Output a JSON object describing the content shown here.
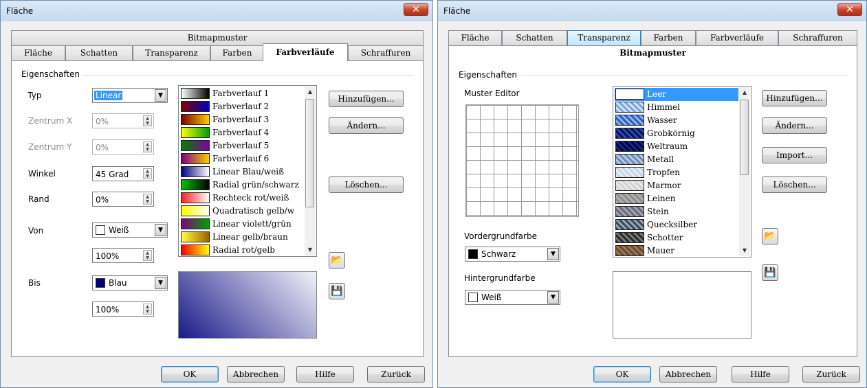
{
  "left_dialog": {
    "title": "Fläche",
    "close_glyph": "✕",
    "tabs_row1": [
      "Bitmapmuster"
    ],
    "tabs_row2": [
      "Fläche",
      "Schatten",
      "Transparenz",
      "Farben",
      "Farbverläufe",
      "Schraffuren"
    ],
    "selected_tab": "Farbverläufe",
    "group_label": "Eigenschaften",
    "labels": {
      "typ": "Typ",
      "zentrum_x": "Zentrum X",
      "zentrum_y": "Zentrum Y",
      "winkel": "Winkel",
      "rand": "Rand",
      "von": "Von",
      "bis": "Bis"
    },
    "typ_value": "Linear",
    "zentrum_x_value": "0%",
    "zentrum_y_value": "0%",
    "winkel_value": "45 Grad",
    "rand_value": "0%",
    "von_color_name": "Weiß",
    "von_color": "#ffffff",
    "von_intensity": "100%",
    "bis_color_name": "Blau",
    "bis_color": "#000080",
    "bis_intensity": "100%",
    "gradients": [
      {
        "name": "Farbverlauf 1",
        "c1": "#ffffff",
        "c2": "#000000"
      },
      {
        "name": "Farbverlauf 2",
        "c1": "#800000",
        "c2": "#0000c0"
      },
      {
        "name": "Farbverlauf 3",
        "c1": "#800000",
        "c2": "#ffcc00"
      },
      {
        "name": "Farbverlauf 4",
        "c1": "#ffff00",
        "c2": "#00a000"
      },
      {
        "name": "Farbverlauf 5",
        "c1": "#008000",
        "c2": "#8000a0"
      },
      {
        "name": "Farbverlauf 6",
        "c1": "#800080",
        "c2": "#ffcc00"
      },
      {
        "name": "Linear Blau/weiß",
        "c1": "#000080",
        "c2": "#ffffff"
      },
      {
        "name": "Radial grün/schwarz",
        "c1": "#00c000",
        "c2": "#000000"
      },
      {
        "name": "Rechteck rot/weiß",
        "c1": "#ff2020",
        "c2": "#ffffff"
      },
      {
        "name": "Quadratisch gelb/w",
        "c1": "#ffff00",
        "c2": "#ffffff"
      },
      {
        "name": "Linear violett/grün",
        "c1": "#800080",
        "c2": "#00a000"
      },
      {
        "name": "Linear gelb/braun",
        "c1": "#ffff40",
        "c2": "#a06000"
      },
      {
        "name": "Radial rot/gelb",
        "c1": "#ff0000",
        "c2": "#ffff00"
      }
    ],
    "buttons": {
      "hinzufuegen": "Hinzufügen...",
      "aendern": "Ändern...",
      "loeschen": "Löschen...",
      "ok": "OK",
      "abbrechen": "Abbrechen",
      "hilfe": "Hilfe",
      "zurueck": "Zurück"
    }
  },
  "right_dialog": {
    "title": "Fläche",
    "close_glyph": "✕",
    "tabs_row1": [
      "Fläche",
      "Schatten",
      "Transparenz",
      "Farben",
      "Farbverläufe",
      "Schraffuren"
    ],
    "highlighted_tab": "Transparenz",
    "selected_tab": "Bitmapmuster",
    "group_label": "Eigenschaften",
    "muster_editor_label": "Muster Editor",
    "vordergrund_label": "Vordergrundfarbe",
    "vordergrund_value": "Schwarz",
    "vordergrund_color": "#000000",
    "hintergrund_label": "Hintergrundfarbe",
    "hintergrund_value": "Weiß",
    "hintergrund_color": "#ffffff",
    "bitmaps": [
      {
        "name": "Leer",
        "c1": "#ffffff",
        "c2": "#ffffff"
      },
      {
        "name": "Himmel",
        "c1": "#7aa7e0",
        "c2": "#d6e6fa"
      },
      {
        "name": "Wasser",
        "c1": "#2e62b8",
        "c2": "#8fb7ef"
      },
      {
        "name": "Grobkörnig",
        "c1": "#0a1450",
        "c2": "#2f49b8"
      },
      {
        "name": "Weltraum",
        "c1": "#00053a",
        "c2": "#1a2a8a"
      },
      {
        "name": "Metall",
        "c1": "#6d8db8",
        "c2": "#b9cbe3"
      },
      {
        "name": "Tropfen",
        "c1": "#e6edf5",
        "c2": "#c6d3e3"
      },
      {
        "name": "Marmor",
        "c1": "#e8e8e8",
        "c2": "#cfcfcf"
      },
      {
        "name": "Leinen",
        "c1": "#b0b0b0",
        "c2": "#8a8a8a"
      },
      {
        "name": "Stein",
        "c1": "#6a6a7a",
        "c2": "#a5a5b5"
      },
      {
        "name": "Quecksilber",
        "c1": "#3a4a5a",
        "c2": "#9aaaba"
      },
      {
        "name": "Schotter",
        "c1": "#2a2a2a",
        "c2": "#7a7a7a"
      },
      {
        "name": "Mauer",
        "c1": "#6a4a2a",
        "c2": "#9a7a5a"
      }
    ],
    "buttons": {
      "hinzufuegen": "Hinzufügen...",
      "aendern": "Ändern...",
      "import": "Import...",
      "loeschen": "Löschen...",
      "ok": "OK",
      "abbrechen": "Abbrechen",
      "hilfe": "Hilfe",
      "zurueck": "Zurück"
    }
  }
}
